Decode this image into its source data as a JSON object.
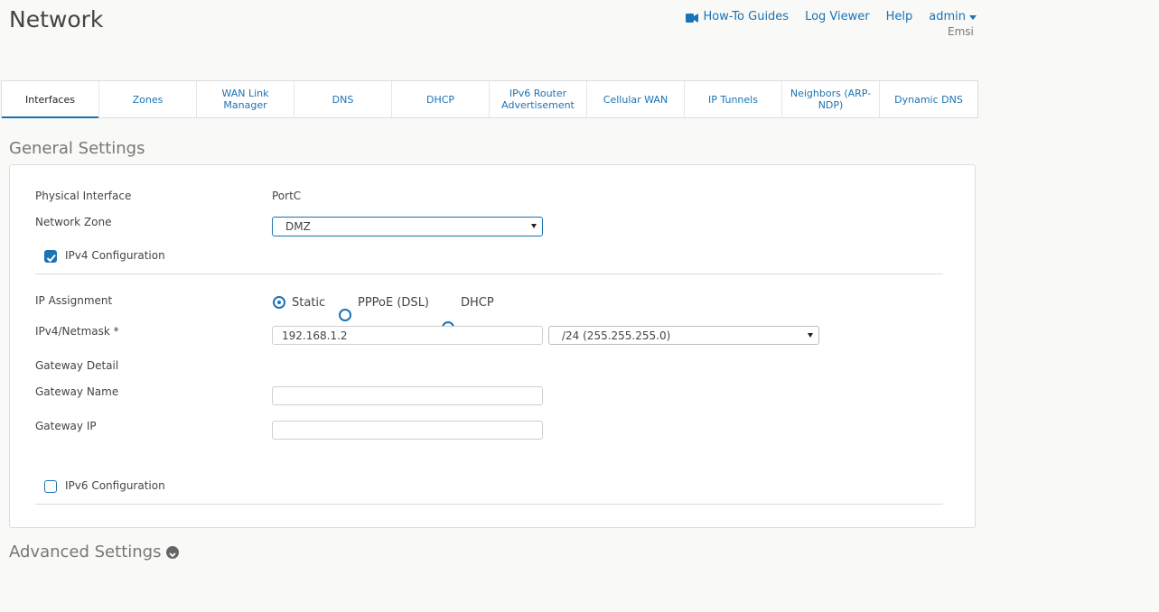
{
  "header": {
    "title": "Network",
    "links": {
      "how_to": "How-To Guides",
      "log_viewer": "Log Viewer",
      "help": "Help",
      "user": "admin",
      "user_sub": "Emsi"
    }
  },
  "tabs": [
    {
      "label": "Interfaces",
      "active": true
    },
    {
      "label": "Zones"
    },
    {
      "label": "WAN Link Manager"
    },
    {
      "label": "DNS"
    },
    {
      "label": "DHCP"
    },
    {
      "label": "IPv6 Router Advertisement"
    },
    {
      "label": "Cellular WAN"
    },
    {
      "label": "IP Tunnels"
    },
    {
      "label": "Neighbors (ARP-NDP)"
    },
    {
      "label": "Dynamic DNS"
    }
  ],
  "general": {
    "title": "General Settings",
    "physical_interface_label": "Physical Interface",
    "physical_interface_value": "PortC",
    "network_zone_label": "Network Zone",
    "network_zone_value": "DMZ",
    "ipv4_label": "IPv4 Configuration",
    "ipv4_checked": true,
    "ip_assignment_label": "IP Assignment",
    "ip_assignment_options": [
      "Static",
      "PPPoE (DSL)",
      "DHCP"
    ],
    "ip_assignment_selected": "Static",
    "ipv4_netmask_label": "IPv4/Netmask *",
    "ipv4_value": "192.168.1.2",
    "netmask_value": "/24 (255.255.255.0)",
    "gateway_detail_label": "Gateway Detail",
    "gateway_name_label": "Gateway Name",
    "gateway_name_value": "",
    "gateway_ip_label": "Gateway IP",
    "gateway_ip_value": "",
    "ipv6_label": "IPv6 Configuration",
    "ipv6_checked": false
  },
  "advanced": {
    "title": "Advanced Settings"
  },
  "colors": {
    "accent": "#1a73b5",
    "background": "#f9f9f7"
  }
}
